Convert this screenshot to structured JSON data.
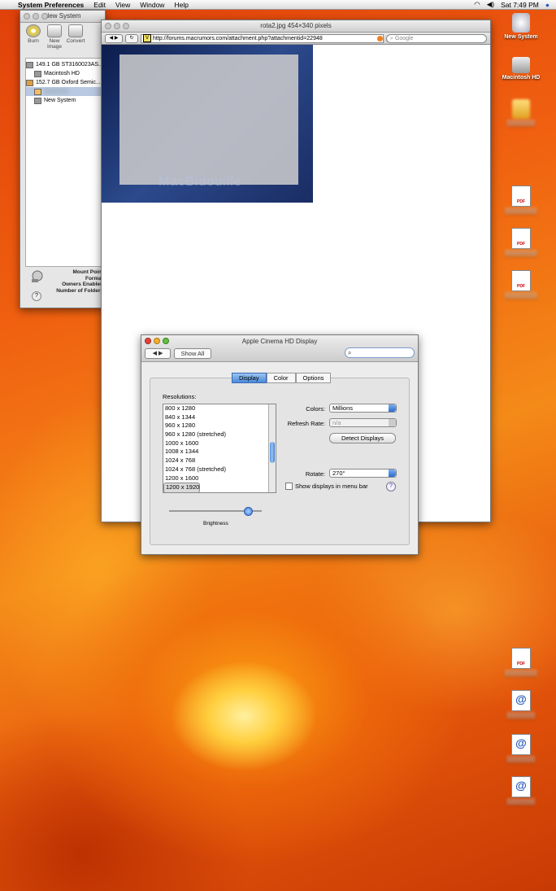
{
  "menubar": {
    "app": "System Preferences",
    "menus": [
      "Edit",
      "View",
      "Window",
      "Help"
    ],
    "clock": "Sat 7:49 PM"
  },
  "disk_utility": {
    "title": "New System",
    "toolbar": [
      "Burn",
      "New Image",
      "Convert"
    ],
    "disks": [
      "149.1 GB ST3160023AS...",
      "Macintosh HD",
      "152.7 GB Oxford Semic...",
      "",
      "New System"
    ],
    "info_labels": [
      "Mount Point",
      "Format",
      "Owners Enabled",
      "Number of Folders"
    ]
  },
  "browser": {
    "title": "rota2.jpg 454×340 pixels",
    "url": "http://forums.macrumors.com/attachment.php?attachmentid=22948",
    "search_placeholder": "Google",
    "thumb_watermark": "MacBidouille"
  },
  "displays": {
    "title": "Apple Cinema HD Display",
    "show_all": "Show All",
    "tabs": [
      "Display",
      "Color",
      "Options"
    ],
    "resolutions_label": "Resolutions:",
    "resolutions": [
      "800 x 1280",
      "840 x 1344",
      "960 x 1280",
      "960 x 1280 (stretched)",
      "1000 x 1600",
      "1008 x 1344",
      "1024 x 768",
      "1024 x 768 (stretched)",
      "1200 x 1600",
      "1200 x 1920"
    ],
    "selected_resolution": "1200 x 1920",
    "colors_label": "Colors:",
    "colors_value": "Millions",
    "refresh_label": "Refresh Rate:",
    "refresh_value": "n/a",
    "detect_button": "Detect Displays",
    "rotate_label": "Rotate:",
    "rotate_value": "270°",
    "menu_bar_checkbox": "Show displays in menu bar",
    "brightness_label": "Brightness",
    "brightness_level": 0.85
  },
  "desktop_icons": [
    {
      "label": "New System",
      "type": "volume"
    },
    {
      "label": "Macintosh HD",
      "type": "drive"
    }
  ]
}
